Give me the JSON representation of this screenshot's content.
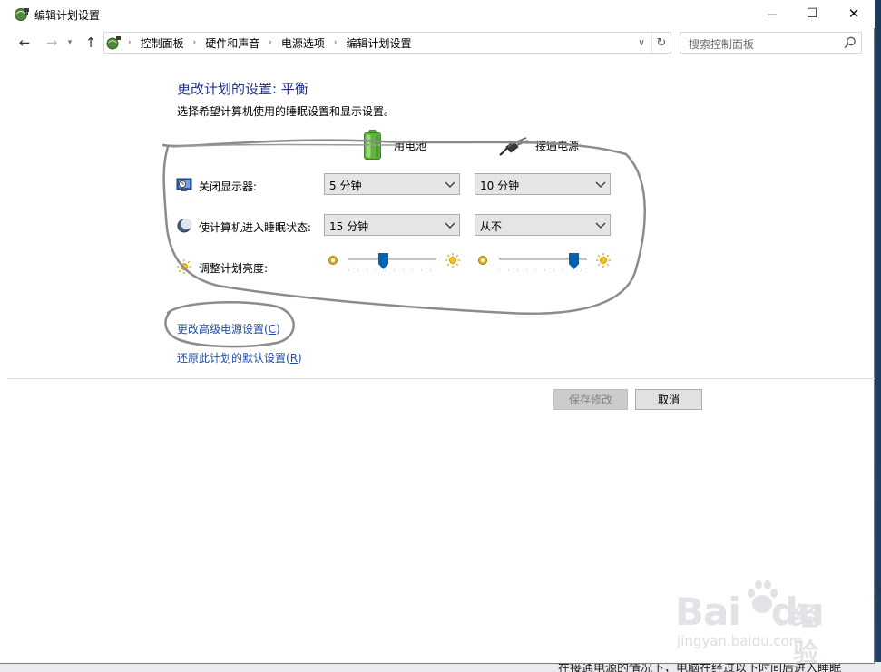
{
  "window": {
    "title": "编辑计划设置",
    "minimize_glyph": "—",
    "maximize_glyph": "☐",
    "close_glyph": "✕"
  },
  "nav": {
    "back_glyph": "←",
    "forward_glyph": "→",
    "dropdown_glyph": "▾",
    "up_glyph": "↑"
  },
  "address": {
    "crumbs": [
      "控制面板",
      "硬件和声音",
      "电源选项",
      "编辑计划设置"
    ],
    "separator": "›",
    "drop_glyph": "∨",
    "refresh_glyph": "↻"
  },
  "search": {
    "placeholder": "搜索控制面板",
    "icon": "search-icon"
  },
  "content": {
    "heading": "更改计划的设置: 平衡",
    "subtitle": "选择希望计算机使用的睡眠设置和显示设置。",
    "columns": {
      "battery_label": "用电池",
      "plugged_label": "接通电源"
    },
    "rows": {
      "display": {
        "label": "关闭显示器:",
        "battery_value": "5 分钟",
        "plugged_value": "10 分钟"
      },
      "sleep": {
        "label": "使计算机进入睡眠状态:",
        "battery_value": "15 分钟",
        "plugged_value": "从不"
      },
      "brightness": {
        "label": "调整计划亮度:",
        "battery_level": 0.4,
        "plugged_level": 0.85
      }
    },
    "links": {
      "advanced": "更改高级电源设置(",
      "advanced_key": "C",
      "advanced_close": ")",
      "restore": "还原此计划的默认设置(",
      "restore_key": "R",
      "restore_close": ")"
    },
    "buttons": {
      "save": "保存修改",
      "cancel": "取消"
    }
  },
  "watermark": {
    "brand": "Bai",
    "brand2": "du",
    "product": "经验",
    "url": "jingyan.baidu.com"
  },
  "caption": "在接通电源的情况下，电脑在经过以下时间后进入睡眠",
  "colors": {
    "heading": "#1e3287",
    "link": "#1f4ea3",
    "slider_thumb": "#0063b1",
    "annotation": "#8c8c8c"
  }
}
